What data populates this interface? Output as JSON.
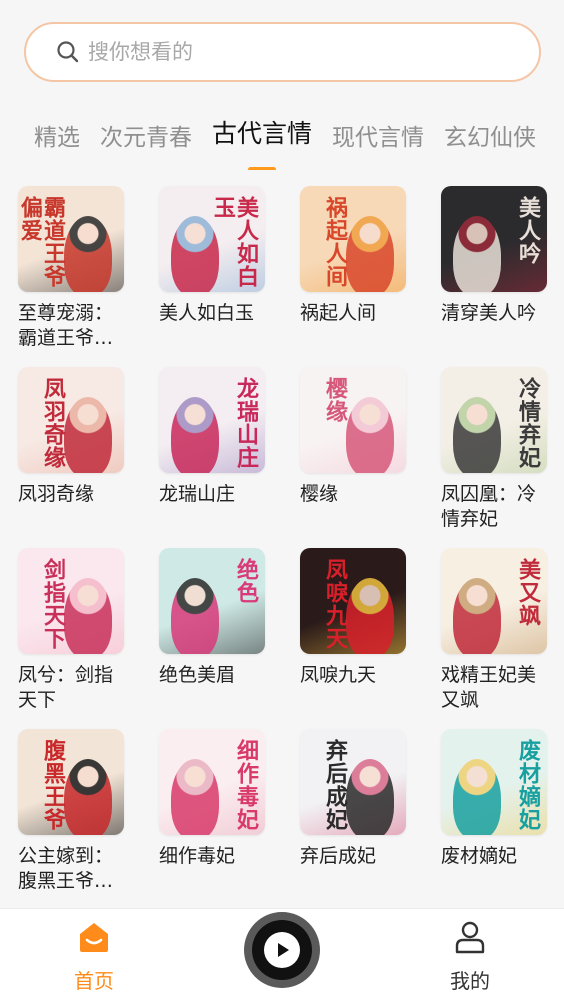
{
  "search": {
    "placeholder": "搜你想看的",
    "icon": "search-icon"
  },
  "tabs": [
    {
      "label": "精选",
      "active": false
    },
    {
      "label": "次元青春",
      "active": false
    },
    {
      "label": "古代言情",
      "active": true
    },
    {
      "label": "现代言情",
      "active": false
    },
    {
      "label": "玄幻仙侠",
      "active": false
    }
  ],
  "books": [
    {
      "title": "至尊宠溺：霸道王爷…",
      "cover_text": "霸道王爷偏爱",
      "colors": [
        "#f3e4d6",
        "#c8372b",
        "#2a2a2a"
      ]
    },
    {
      "title": "美人如白玉",
      "cover_text": "美人如白玉",
      "colors": [
        "#f5eef0",
        "#c8284a",
        "#8fb2d6"
      ]
    },
    {
      "title": "祸起人间",
      "cover_text": "祸起人间",
      "colors": [
        "#f7d9b8",
        "#d9472b",
        "#f0a040"
      ]
    },
    {
      "title": "清穿美人吟",
      "cover_text": "美人吟",
      "colors": [
        "#2b2b2e",
        "#e8e0d8",
        "#9c2a3a"
      ]
    },
    {
      "title": "凤羽奇缘",
      "cover_text": "凤羽奇缘",
      "colors": [
        "#f7e9e4",
        "#c02a3a",
        "#e9b0a0"
      ]
    },
    {
      "title": "龙瑞山庄",
      "cover_text": "龙瑞山庄",
      "colors": [
        "#f4eef2",
        "#c8285a",
        "#a08cc0"
      ]
    },
    {
      "title": "樱缘",
      "cover_text": "樱缘",
      "colors": [
        "#f8f3f3",
        "#d6587a",
        "#f2c4d2"
      ]
    },
    {
      "title": "凤囚凰：冷情弃妃",
      "cover_text": "冷情弃妃",
      "colors": [
        "#f4efe6",
        "#3a3a3a",
        "#b8cfa0"
      ]
    },
    {
      "title": "凤兮：剑指天下",
      "cover_text": "剑指天下",
      "colors": [
        "#fbe7ee",
        "#c8305a",
        "#f4b8c8"
      ]
    },
    {
      "title": "绝色美眉",
      "cover_text": "绝色",
      "colors": [
        "#cfeae6",
        "#d83a7a",
        "#2a2a2a"
      ]
    },
    {
      "title": "凤唳九天",
      "cover_text": "凤唳九天",
      "colors": [
        "#2a1a1a",
        "#d8202a",
        "#f0c040"
      ]
    },
    {
      "title": "戏精王妃美又飒",
      "cover_text": "美又飒",
      "colors": [
        "#f7efe2",
        "#c02a3a",
        "#c8a070"
      ]
    },
    {
      "title": "公主嫁到：腹黑王爷…",
      "cover_text": "腹黑王爷",
      "colors": [
        "#f2e4d6",
        "#c8282a",
        "#1a1a1a"
      ]
    },
    {
      "title": "细作毒妃",
      "cover_text": "细作毒妃",
      "colors": [
        "#fbeef0",
        "#d83a6a",
        "#e8b0c0"
      ]
    },
    {
      "title": "弃后成妃",
      "cover_text": "弃后成妃",
      "colors": [
        "#f2f2f4",
        "#2a2a2a",
        "#d86a8a"
      ]
    },
    {
      "title": "废材嫡妃",
      "cover_text": "废材嫡妃",
      "colors": [
        "#e4f2ee",
        "#18a0a0",
        "#f0d070"
      ]
    }
  ],
  "nav": {
    "home_label": "首页",
    "mine_label": "我的",
    "accent": "#ff8c1a",
    "home_icon": "home-icon",
    "mine_icon": "user-icon",
    "player_icon": "play-icon"
  }
}
